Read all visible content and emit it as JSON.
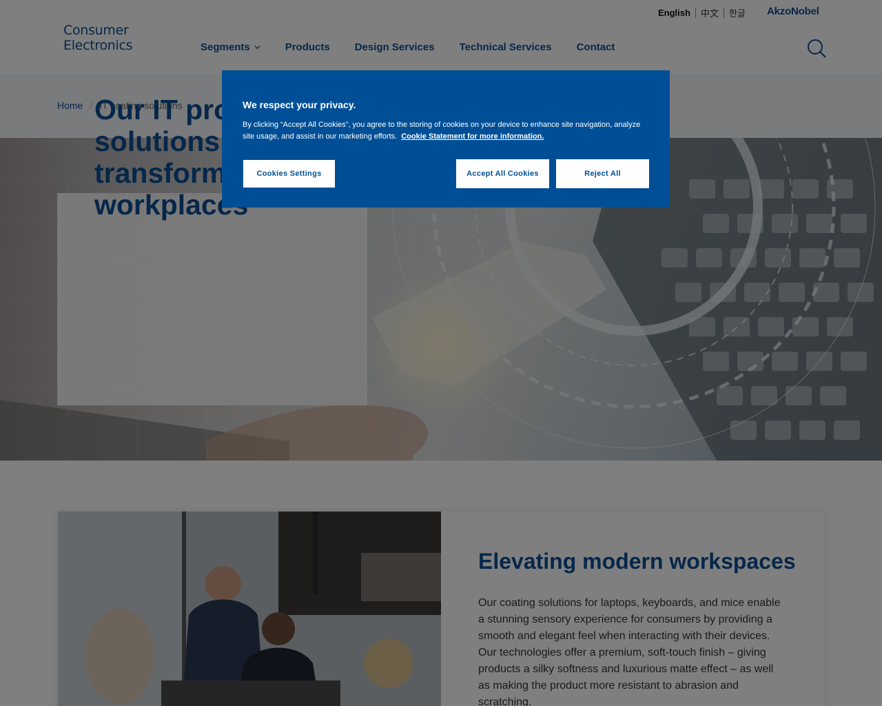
{
  "header": {
    "logo_line1": "Consumer",
    "logo_line2": "Electronics",
    "languages": [
      "English",
      "中文",
      "한글"
    ],
    "brand": "AkzoNobel",
    "nav": [
      "Segments",
      "Products",
      "Design Services",
      "Technical Services",
      "Contact"
    ]
  },
  "breadcrumb": {
    "home": "Home",
    "separator": "/",
    "current": "IT coating solutions"
  },
  "hero": {
    "title_part1": "Our ",
    "title_bold": "IT product solutions",
    "title_part2": " are transforming workplaces"
  },
  "section": {
    "title": "Elevating modern workspaces",
    "body": "Our coating solutions for laptops, keyboards, and mice enable a stunning sensory experience for consumers by providing a smooth and elegant feel when interacting with their devices. Our technologies offer a premium, soft-touch finish – giving products a silky softness and luxurious matte effect – as well as making the product more resistant to abrasion and scratching."
  },
  "cookie": {
    "title": "We respect your privacy.",
    "text": "By clicking “Accept All Cookies”, you agree to the storing of cookies on your device to enhance site navigation, analyze site usage, and assist in our marketing efforts.",
    "link": "Cookie Statement for more information.",
    "settings_label": "Cookies Settings",
    "accept_label": "Accept All Cookies",
    "reject_label": "Reject All"
  },
  "colors": {
    "brand_blue": "#0d4f95",
    "banner_blue": "#004f96"
  }
}
